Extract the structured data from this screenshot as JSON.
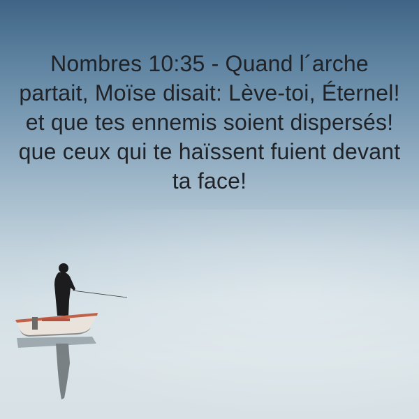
{
  "verse": {
    "text": "Nombres 10:35 - Quand l´arche partait, Moïse disait: Lève-toi, Éternel! et que tes ennemis soient dispersés! que ceux qui te haïssent fuient devant ta face!"
  },
  "colors": {
    "sky_top": "#3f6485",
    "water": "#d8e2e6",
    "text": "#1f2328",
    "boat_hull": "#e9e3db",
    "boat_trim": "#c0614a",
    "figure": "#1c1b1d"
  }
}
